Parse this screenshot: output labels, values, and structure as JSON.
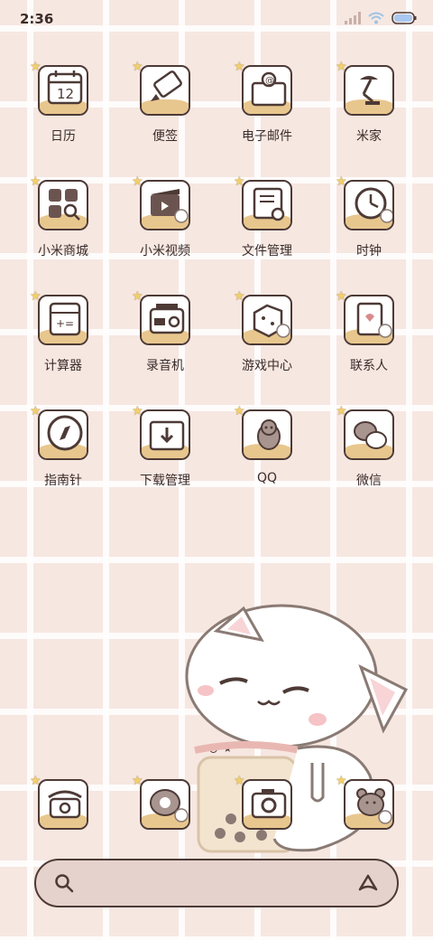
{
  "status_bar": {
    "time": "2:36",
    "signal_icon": "signal-icon",
    "wifi_icon": "wifi-icon",
    "battery_icon": "battery-icon"
  },
  "apps": [
    {
      "label": "日历",
      "icon": "calendar-icon",
      "day": "12"
    },
    {
      "label": "便签",
      "icon": "notes-icon"
    },
    {
      "label": "电子邮件",
      "icon": "email-icon"
    },
    {
      "label": "米家",
      "icon": "mijia-lamp-icon"
    },
    {
      "label": "小米商城",
      "icon": "mi-store-icon"
    },
    {
      "label": "小米视频",
      "icon": "mi-video-icon"
    },
    {
      "label": "文件管理",
      "icon": "file-manager-icon"
    },
    {
      "label": "时钟",
      "icon": "clock-icon"
    },
    {
      "label": "计算器",
      "icon": "calculator-icon"
    },
    {
      "label": "录音机",
      "icon": "recorder-icon"
    },
    {
      "label": "游戏中心",
      "icon": "game-center-icon"
    },
    {
      "label": "联系人",
      "icon": "contacts-icon"
    },
    {
      "label": "指南针",
      "icon": "compass-icon"
    },
    {
      "label": "下载管理",
      "icon": "download-manager-icon"
    },
    {
      "label": "QQ",
      "icon": "qq-icon"
    },
    {
      "label": "微信",
      "icon": "wechat-icon"
    }
  ],
  "dock": [
    {
      "icon": "phone-icon"
    },
    {
      "icon": "messages-bear-icon"
    },
    {
      "icon": "camera-icon"
    },
    {
      "icon": "bear-face-icon"
    }
  ],
  "page_indicator": {
    "icons": [
      "list-icon",
      "dot-icon",
      "star-icon"
    ]
  },
  "search_bar": {
    "search_icon": "search-icon",
    "assistant_icon": "assistant-icon"
  },
  "colors": {
    "background": "#f6e7e1",
    "outline": "#4d3a36",
    "ground": "#e8c78e",
    "star": "#f2cf6b"
  }
}
